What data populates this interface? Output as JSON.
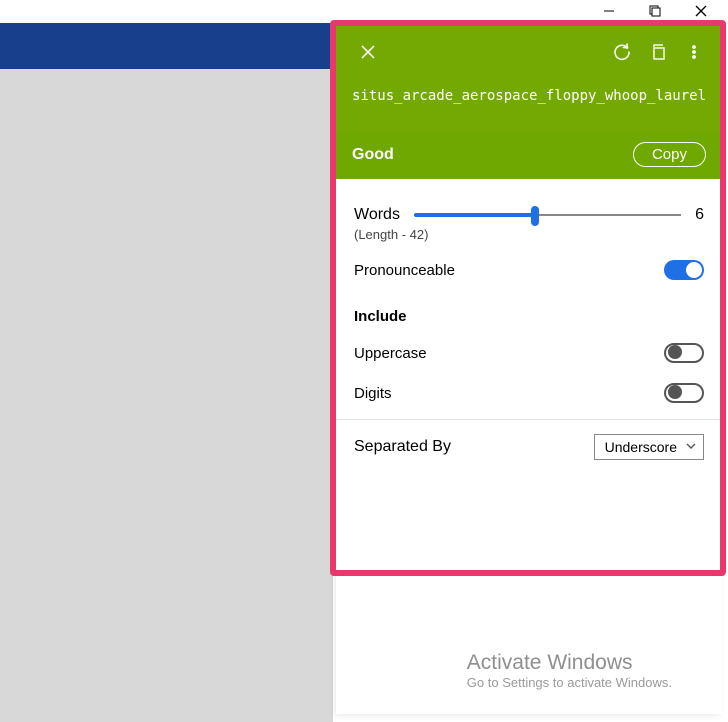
{
  "header": {
    "password": "situs_arcade_aerospace_floppy_whoop_laurel",
    "strength_label": "Good",
    "copy_label": "Copy"
  },
  "words": {
    "label": "Words",
    "value": 6,
    "min": 1,
    "max": 12,
    "length_label": "(Length - 42)"
  },
  "options": {
    "pronounceable": {
      "label": "Pronounceable",
      "on": true
    },
    "include_title": "Include",
    "uppercase": {
      "label": "Uppercase",
      "on": false
    },
    "digits": {
      "label": "Digits",
      "on": false
    }
  },
  "separator": {
    "label": "Separated By",
    "selected": "Underscore"
  },
  "watermark": {
    "line1": "Activate Windows",
    "line2": "Go to Settings to activate Windows."
  },
  "chart_data": {
    "type": "table",
    "title": "Password generator settings",
    "series": [
      {
        "name": "Words",
        "values": [
          6
        ]
      },
      {
        "name": "Length",
        "values": [
          42
        ]
      },
      {
        "name": "Pronounceable",
        "values": [
          true
        ]
      },
      {
        "name": "Uppercase",
        "values": [
          false
        ]
      },
      {
        "name": "Digits",
        "values": [
          false
        ]
      },
      {
        "name": "Separator",
        "values": [
          "Underscore"
        ]
      }
    ]
  }
}
